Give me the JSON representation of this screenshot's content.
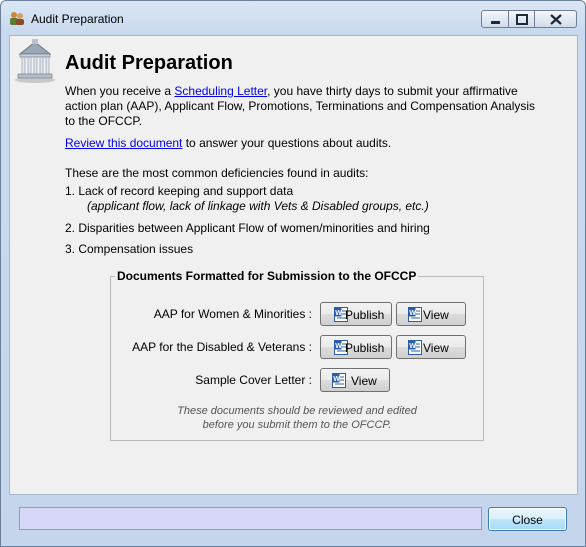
{
  "window": {
    "title": "Audit Preparation"
  },
  "header": {
    "title": "Audit Preparation"
  },
  "intro": {
    "prefix": "When you receive a ",
    "link": "Scheduling Letter",
    "line1_rest": ", you have thirty days to submit your affirmative",
    "line2": "action plan (AAP), Applicant Flow, Promotions, Terminations and Compensation Analysis",
    "line3": "to the OFCCP."
  },
  "review": {
    "link": "Review this document",
    "rest": " to answer your questions about audits."
  },
  "deficiencies": {
    "heading": "These are the most common deficiencies found in audits:",
    "item1": "1. Lack of record keeping and support data",
    "item1_sub": "(applicant flow, lack of linkage with Vets & Disabled groups, etc.)",
    "item2": "2. Disparities between Applicant Flow of women/minorities and hiring",
    "item3": "3. Compensation issues"
  },
  "documents": {
    "group_title": "Documents Formatted for Submission to the OFCCP",
    "row1_label": "AAP for Women & Minorities :",
    "row2_label": "AAP for the Disabled & Veterans :",
    "row3_label": "Sample Cover Letter :",
    "publish_label": "Publish",
    "view_label": "View",
    "note_line1": "These documents should be reviewed and edited",
    "note_line2": "before you submit them to the OFCCP."
  },
  "footer": {
    "status": "",
    "close_label": "Close"
  },
  "colors": {
    "link": "#0000ee",
    "status_bg": "#d7d7f7",
    "word_icon": "#2a5caa"
  }
}
